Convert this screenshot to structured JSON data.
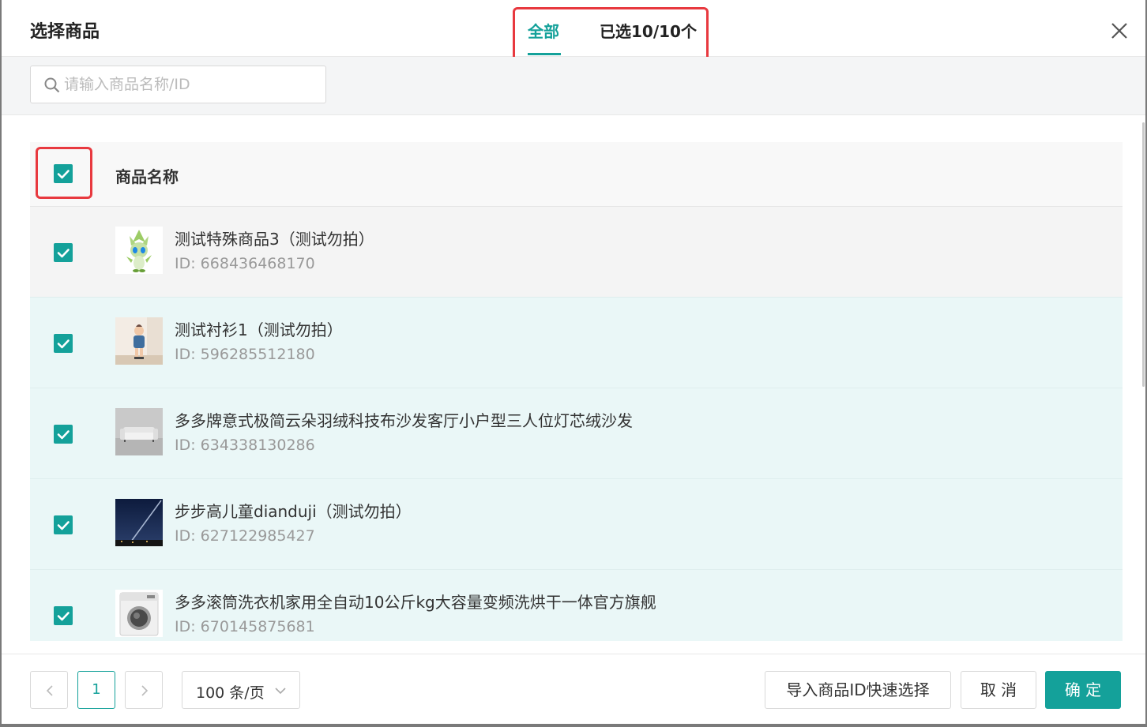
{
  "header": {
    "title": "选择商品",
    "tabs": [
      {
        "label": "全部",
        "active": true
      },
      {
        "label": "已选10/10个",
        "active": false
      }
    ]
  },
  "search": {
    "placeholder": "请输入商品名称/ID",
    "value": ""
  },
  "table": {
    "select_all_checked": true,
    "column_header": "商品名称",
    "rows": [
      {
        "name": "测试特殊商品3（测试勿拍）",
        "id": "ID: 668436468170",
        "checked": true,
        "thumb": "green-character-image"
      },
      {
        "name": "测试衬衫1（测试勿拍）",
        "id": "ID: 596285512180",
        "checked": true,
        "thumb": "child-photo-image"
      },
      {
        "name": "多多牌意式极简云朵羽绒科技布沙发客厅小户型三人位灯芯绒沙发",
        "id": "ID: 634338130286",
        "checked": true,
        "thumb": "sofa-image"
      },
      {
        "name": "步步高儿童dianduji（测试勿拍）",
        "id": "ID: 627122985427",
        "checked": true,
        "thumb": "night-sky-image"
      },
      {
        "name": "多多滚筒洗衣机家用全自动10公斤kg大容量变频洗烘干一体官方旗舰",
        "id": "ID: 670145875681",
        "checked": true,
        "thumb": "washing-machine-image"
      }
    ]
  },
  "pagination": {
    "current_page": "1",
    "page_size": "100 条/页"
  },
  "footer": {
    "import_label": "导入商品ID快速选择",
    "cancel_label": "取 消",
    "confirm_label": "确 定"
  },
  "colors": {
    "accent": "#14a19a",
    "highlight_outline": "#e8393f",
    "row_selected_bg": "#eaf7f7",
    "row_hover_bg": "#f4f4f4"
  }
}
